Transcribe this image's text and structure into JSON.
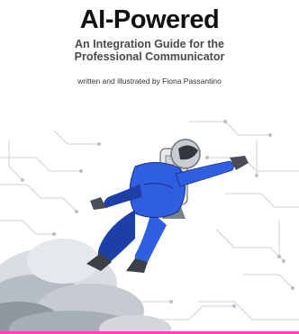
{
  "cover": {
    "title": "AI-Powered",
    "subtitle_line1": "An Integration Guide for the",
    "subtitle_line2": "Professional Communicator",
    "byline": "written and illustrated by Fiona Passantino"
  },
  "colors": {
    "suit": "#2f5fe0",
    "suit_shadow": "#1f3fa8",
    "circuit": "#c7ccd3",
    "cloud": "#9aa3ab",
    "accent_bar": "#ff3fbf"
  },
  "icons": {
    "illustration": "jetpack-astronaut-illustration"
  }
}
